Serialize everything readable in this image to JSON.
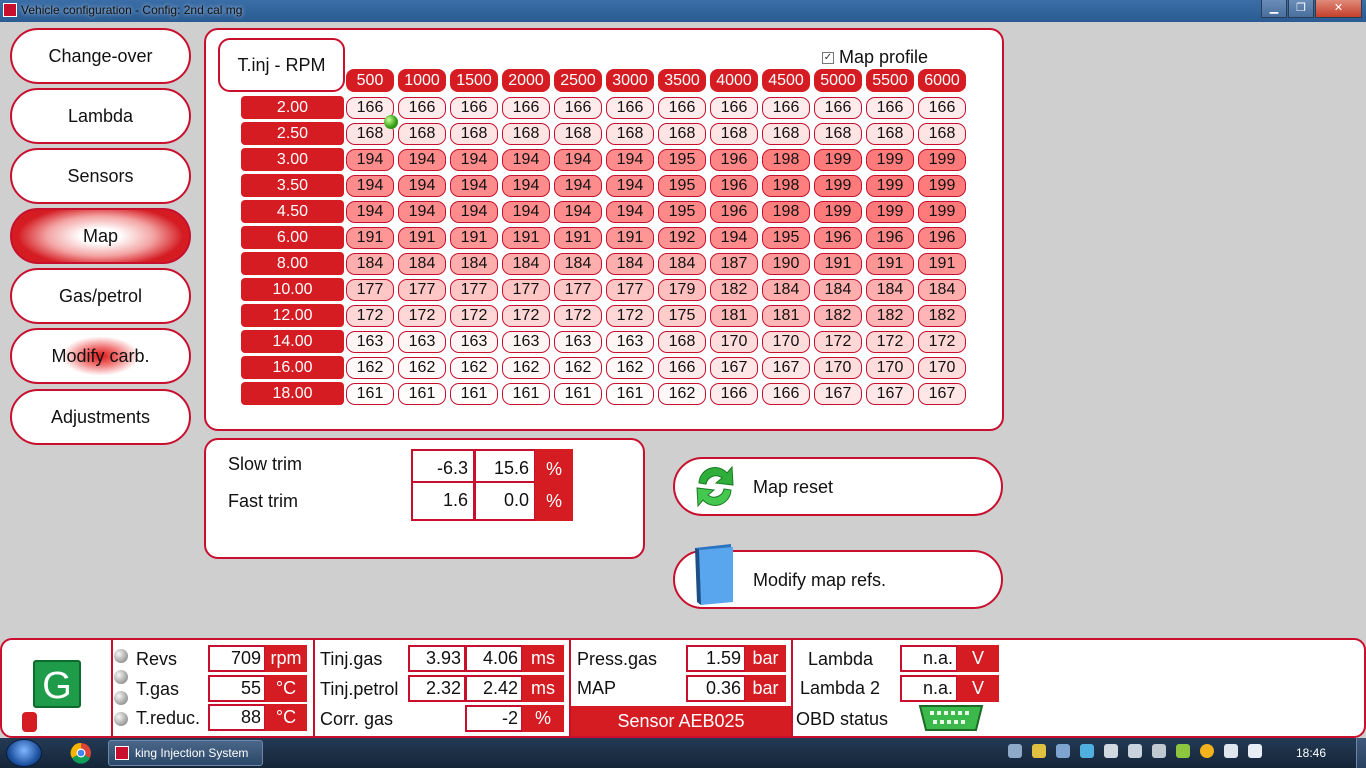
{
  "window": {
    "title": "Vehicle configuration - Config: 2nd cal mg",
    "minimize": "▁",
    "maximize": "❐",
    "close": "✕"
  },
  "nav": {
    "items": [
      {
        "label": "Change-over"
      },
      {
        "label": "Lambda"
      },
      {
        "label": "Sensors"
      },
      {
        "label": "Map"
      },
      {
        "label": "Gas/petrol"
      },
      {
        "label": "Modify carb."
      },
      {
        "label": "Adjustments"
      }
    ],
    "active": "Map"
  },
  "map": {
    "axis_label": "T.inj - RPM",
    "profile_label": "Map profile",
    "profile_checked": true,
    "rpm": [
      "500",
      "1000",
      "1500",
      "2000",
      "2500",
      "3000",
      "3500",
      "4000",
      "4500",
      "5000",
      "5500",
      "6000"
    ],
    "load": [
      "2.00",
      "2.50",
      "3.00",
      "3.50",
      "4.50",
      "6.00",
      "8.00",
      "10.00",
      "12.00",
      "14.00",
      "16.00",
      "18.00"
    ],
    "values": [
      [
        "166",
        "166",
        "166",
        "166",
        "166",
        "166",
        "166",
        "166",
        "166",
        "166",
        "166",
        "166"
      ],
      [
        "168",
        "168",
        "168",
        "168",
        "168",
        "168",
        "168",
        "168",
        "168",
        "168",
        "168",
        "168"
      ],
      [
        "194",
        "194",
        "194",
        "194",
        "194",
        "194",
        "195",
        "196",
        "198",
        "199",
        "199",
        "199"
      ],
      [
        "194",
        "194",
        "194",
        "194",
        "194",
        "194",
        "195",
        "196",
        "198",
        "199",
        "199",
        "199"
      ],
      [
        "194",
        "194",
        "194",
        "194",
        "194",
        "194",
        "195",
        "196",
        "198",
        "199",
        "199",
        "199"
      ],
      [
        "191",
        "191",
        "191",
        "191",
        "191",
        "191",
        "192",
        "194",
        "195",
        "196",
        "196",
        "196"
      ],
      [
        "184",
        "184",
        "184",
        "184",
        "184",
        "184",
        "184",
        "187",
        "190",
        "191",
        "191",
        "191"
      ],
      [
        "177",
        "177",
        "177",
        "177",
        "177",
        "177",
        "179",
        "182",
        "184",
        "184",
        "184",
        "184"
      ],
      [
        "172",
        "172",
        "172",
        "172",
        "172",
        "172",
        "175",
        "181",
        "181",
        "182",
        "182",
        "182"
      ],
      [
        "163",
        "163",
        "163",
        "163",
        "163",
        "163",
        "168",
        "170",
        "170",
        "172",
        "172",
        "172"
      ],
      [
        "162",
        "162",
        "162",
        "162",
        "162",
        "162",
        "166",
        "167",
        "167",
        "170",
        "170",
        "170"
      ],
      [
        "161",
        "161",
        "161",
        "161",
        "161",
        "161",
        "162",
        "166",
        "166",
        "167",
        "167",
        "167"
      ]
    ]
  },
  "trim": {
    "slow": {
      "label": "Slow trim",
      "v1": "-6.3",
      "v2": "15.6",
      "unit": "%"
    },
    "fast": {
      "label": "Fast trim",
      "v1": "1.6",
      "v2": "0.0",
      "unit": "%"
    }
  },
  "actions": {
    "map_reset": "Map reset",
    "modify_refs": "Modify map refs."
  },
  "status": {
    "logo": "G",
    "revs": {
      "label": "Revs",
      "value": "709",
      "unit": "rpm"
    },
    "tgas": {
      "label": "T.gas",
      "value": "55",
      "unit": "°C"
    },
    "treduc": {
      "label": "T.reduc.",
      "value": "88",
      "unit": "°C"
    },
    "tinj_gas": {
      "label": "Tinj.gas",
      "v1": "3.93",
      "v2": "4.06",
      "unit": "ms"
    },
    "tinj_petrol": {
      "label": "Tinj.petrol",
      "v1": "2.32",
      "v2": "2.42",
      "unit": "ms"
    },
    "corr_gas": {
      "label": "Corr. gas",
      "value": "-2",
      "unit": "%"
    },
    "press_gas": {
      "label": "Press.gas",
      "value": "1.59",
      "unit": "bar"
    },
    "map": {
      "label": "MAP",
      "value": "0.36",
      "unit": "bar"
    },
    "sensor": "Sensor AEB025",
    "lambda": {
      "label": "Lambda",
      "value": "n.a.",
      "unit": "V"
    },
    "lambda2": {
      "label": "Lambda 2",
      "value": "n.a.",
      "unit": "V"
    },
    "obd": {
      "label": "OBD status"
    }
  },
  "taskbar": {
    "app_label": "king Injection System",
    "clock": "18:46"
  },
  "colors": {
    "accent": "#d41c22",
    "border": "#c8102e"
  }
}
